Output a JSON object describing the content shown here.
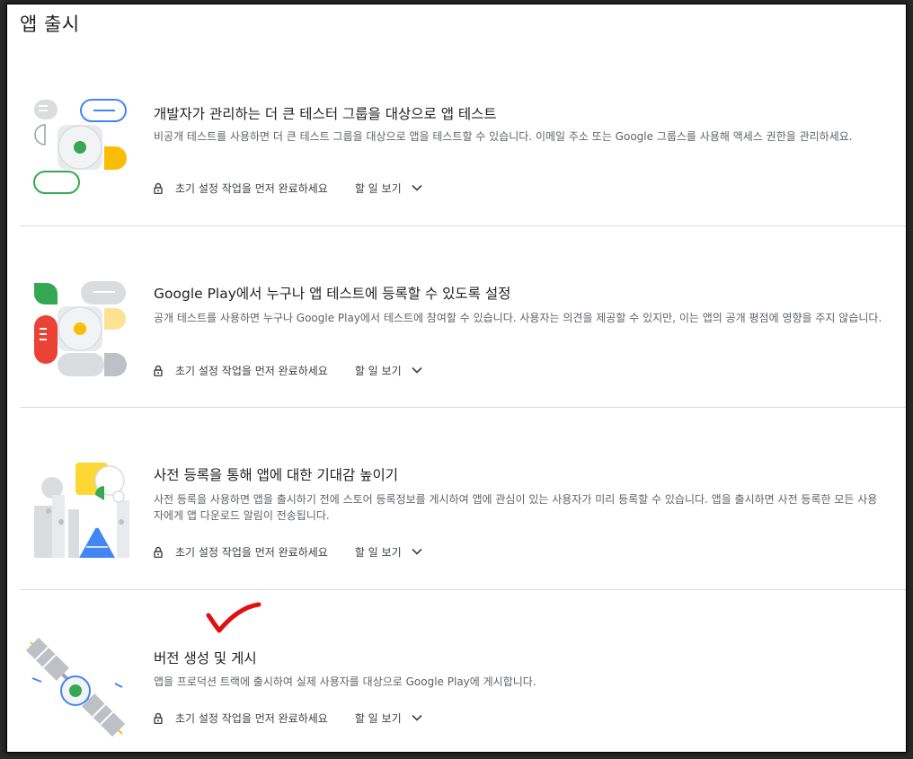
{
  "page": {
    "title": "앱 출시"
  },
  "sections": [
    {
      "title": "개발자가 관리하는 더 큰 테스터 그룹을 대상으로 앱 테스트",
      "description": "비공개 테스트를 사용하면 더 큰 테스트 그룹을 대상으로 앱을 테스트할 수 있습니다. 이메일 주소 또는 Google 그룹스를 사용해 액세스 권한을 관리하세요.",
      "locked_text": "초기 설정 작업을 먼저 완료하세요",
      "todo_label": "할 일 보기"
    },
    {
      "title": "Google Play에서 누구나 앱 테스트에 등록할 수 있도록 설정",
      "description": "공개 테스트를 사용하면 누구나 Google Play에서 테스트에 참여할 수 있습니다. 사용자는 의견을 제공할 수 있지만, 이는 앱의 공개 평점에 영향을 주지 않습니다.",
      "locked_text": "초기 설정 작업을 먼저 완료하세요",
      "todo_label": "할 일 보기"
    },
    {
      "title": "사전 등록을 통해 앱에 대한 기대감 높이기",
      "description": "사전 등록을 사용하면 앱을 출시하기 전에 스토어 등록정보를 게시하여 앱에 관심이 있는 사용자가 미리 등록할 수 있습니다. 앱을 출시하면 사전 등록한 모든 사용자에게 앱 다운로드 알림이 전송됩니다.",
      "locked_text": "초기 설정 작업을 먼저 완료하세요",
      "todo_label": "할 일 보기"
    },
    {
      "title": "버전 생성 및 게시",
      "description": "앱을 프로덕션 트랙에 출시하여 실제 사용자를 대상으로 Google Play에 게시합니다.",
      "locked_text": "초기 설정 작업을 먼저 완료하세요",
      "todo_label": "할 일 보기"
    }
  ],
  "icons": {
    "lock": "lock-icon",
    "chevron": "chevron-down-icon",
    "annotation": "red-checkmark"
  },
  "colors": {
    "green": "#34a853",
    "yellow": "#fbbc04",
    "red": "#ea4335",
    "blue": "#4285f4",
    "grey": "#dadce0",
    "annotation_red": "#e01010"
  }
}
